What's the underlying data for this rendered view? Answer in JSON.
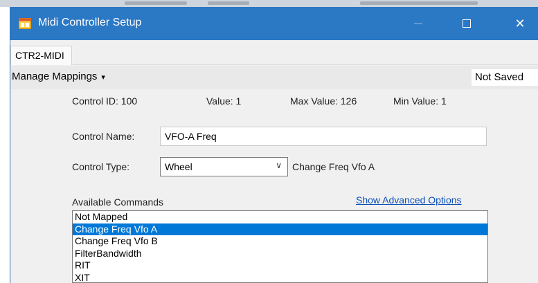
{
  "window": {
    "title": "Midi Controller Setup",
    "controls": {
      "minimize_icon": "minimize-icon",
      "maximize_icon": "maximize-icon",
      "close_icon": "close-icon",
      "close_glyph": "✕"
    }
  },
  "tabs": [
    {
      "label": "CTR2-MIDI"
    }
  ],
  "toolbar": {
    "menu_label": "Manage Mappings",
    "menu_caret": "▾",
    "status": "Not Saved"
  },
  "control": {
    "id": "Control ID: 100",
    "value": "Value: 1",
    "max": "Max Value: 126",
    "min": "Min Value: 1",
    "name_label": "Control Name:",
    "name_value": "VFO-A Freq",
    "type_label": "Control Type:",
    "type_value": "Wheel",
    "type_chevron": "∨",
    "type_description": "Change Freq Vfo A"
  },
  "commands": {
    "label": "Available Commands",
    "advanced_link": "Show Advanced Options",
    "items": [
      "Not Mapped",
      "Change Freq Vfo A",
      "Change Freq Vfo B",
      "FilterBandwidth",
      "RIT",
      "XIT"
    ],
    "selected_index": 1
  },
  "colors": {
    "titlebar": "#2b78c5",
    "selection": "#0078d7",
    "link": "#0b4fb8",
    "window_bg": "#f0f0f0"
  }
}
